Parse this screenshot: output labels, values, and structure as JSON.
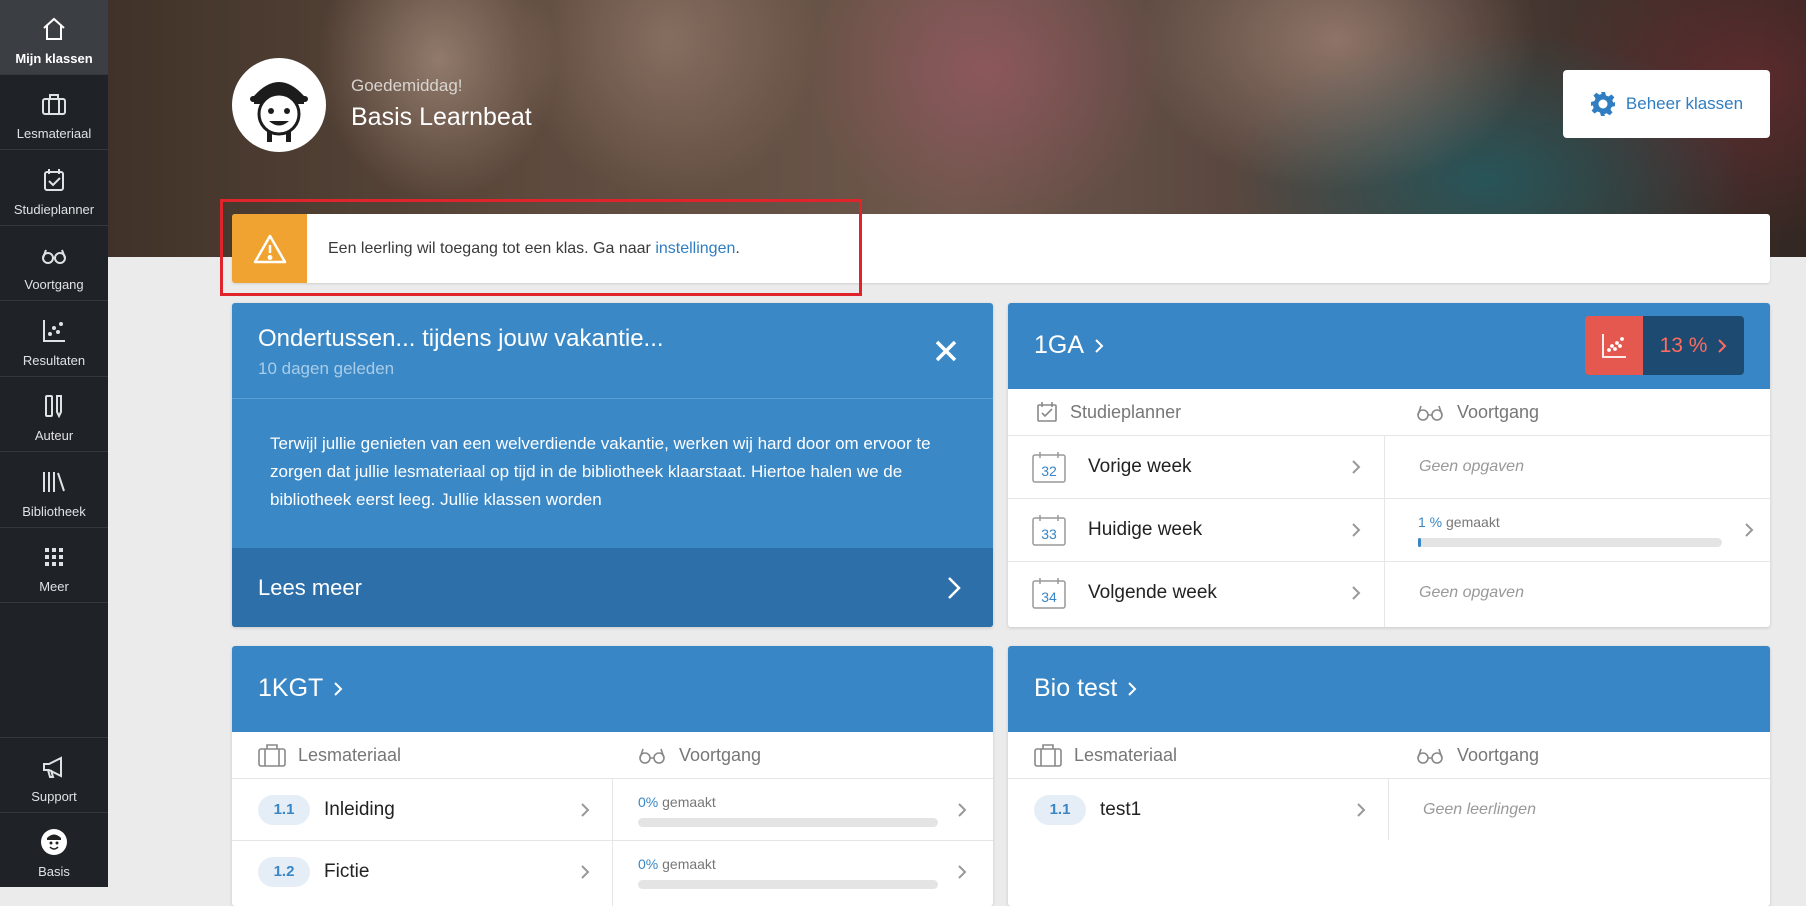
{
  "sidebar": {
    "items": [
      {
        "label": "Mijn klassen",
        "icon": "home-icon"
      },
      {
        "label": "Lesmateriaal",
        "icon": "briefcase-icon"
      },
      {
        "label": "Studieplanner",
        "icon": "calendar-check-icon"
      },
      {
        "label": "Voortgang",
        "icon": "glasses-icon"
      },
      {
        "label": "Resultaten",
        "icon": "scatter-chart-icon"
      },
      {
        "label": "Auteur",
        "icon": "author-icon"
      },
      {
        "label": "Bibliotheek",
        "icon": "books-icon"
      },
      {
        "label": "Meer",
        "icon": "grid-icon"
      }
    ],
    "bottom": [
      {
        "label": "Support",
        "icon": "megaphone-icon"
      },
      {
        "label": "Basis",
        "icon": "avatar-icon"
      }
    ]
  },
  "header": {
    "greeting": "Goedemiddag!",
    "user_name": "Basis Learnbeat",
    "manage_button": "Beheer klassen"
  },
  "alert": {
    "text": "Een leerling wil toegang tot een klas. Ga naar ",
    "link": "instellingen",
    "end": "."
  },
  "news": {
    "title": "Ondertussen... tijdens jouw vakantie...",
    "subtitle": "10 dagen geleden",
    "body": "Terwijl jullie genieten van een welverdiende vakantie, werken wij hard door om ervoor te zorgen dat jullie lesmateriaal op tijd in de bibliotheek klaarstaat. Hiertoe halen we de bibliotheek eerst leeg. Jullie klassen worden",
    "read_more": "Lees meer"
  },
  "class_1ga": {
    "name": "1GA",
    "score": "13 %",
    "col_left": "Studieplanner",
    "col_right": "Voortgang",
    "rows": [
      {
        "week_num": "32",
        "label": "Vorige week",
        "status": "Geen opgaven"
      },
      {
        "week_num": "33",
        "label": "Huidige week",
        "progress_pct": "1 %",
        "progress_suffix": "gemaakt",
        "progress": 0.01
      },
      {
        "week_num": "34",
        "label": "Volgende week",
        "status": "Geen opgaven"
      }
    ]
  },
  "class_1kgt": {
    "name": "1KGT",
    "col_left": "Lesmateriaal",
    "col_right": "Voortgang",
    "rows": [
      {
        "badge": "1.1",
        "label": "Inleiding",
        "progress_pct": "0%",
        "progress_suffix": "gemaakt",
        "progress": 0
      },
      {
        "badge": "1.2",
        "label": "Fictie",
        "progress_pct": "0%",
        "progress_suffix": "gemaakt",
        "progress": 0
      }
    ]
  },
  "class_bio": {
    "name": "Bio test",
    "col_left": "Lesmateriaal",
    "col_right": "Voortgang",
    "rows": [
      {
        "badge": "1.1",
        "label": "test1",
        "status": "Geen leerlingen"
      }
    ]
  }
}
